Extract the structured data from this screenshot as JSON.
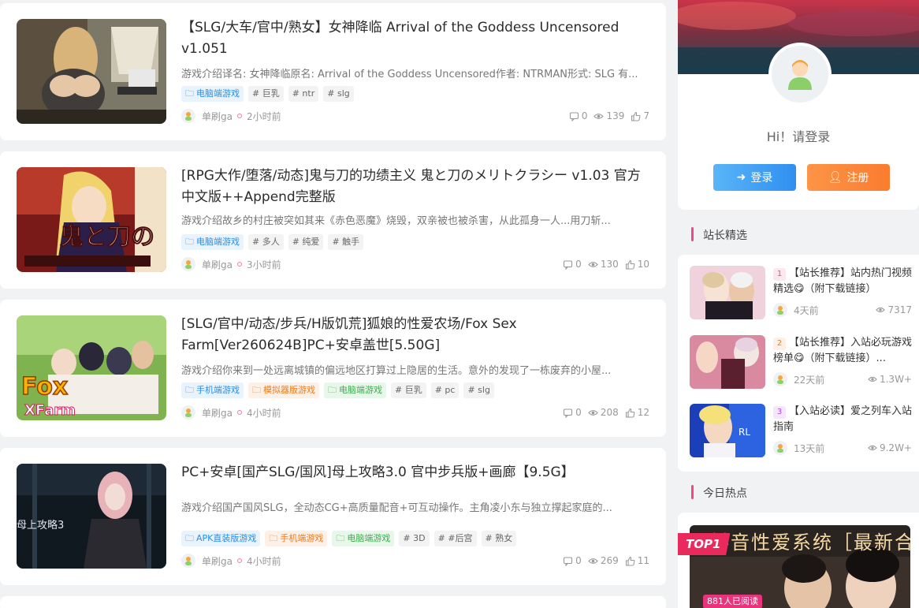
{
  "posts": [
    {
      "title": "【SLG/大车/官中/熟女】女神降临 Arrival of the Goddess Uncensored v1.051",
      "excerpt": "游戏介绍译名: 女神降临原名: Arrival of the Goddess Uncensored作者: NTRMAN形式: SLG 有...",
      "tags": [
        {
          "label": "电脑端游戏",
          "style": "blue",
          "icon": "folder-icon"
        },
        {
          "label": "# 巨乳",
          "style": "gray"
        },
        {
          "label": "# ntr",
          "style": "gray"
        },
        {
          "label": "# slg",
          "style": "gray"
        }
      ],
      "author": "单刷ga",
      "time": "2小时前",
      "comments": "0",
      "views": "139",
      "likes": "7"
    },
    {
      "title": "[RPG大作/堕落/动态]鬼与刀的功绩主义 鬼と刀のメリトクラシー v1.03 官方中文版++Append完整版",
      "excerpt": "游戏介绍故乡的村庄被突如其来《赤色恶魔》烧毁，双亲被也被杀害，从此孤身一人...用刀斩...",
      "tags": [
        {
          "label": "电脑端游戏",
          "style": "blue",
          "icon": "folder-icon"
        },
        {
          "label": "# 多人",
          "style": "gray"
        },
        {
          "label": "# 纯爱",
          "style": "gray"
        },
        {
          "label": "# 触手",
          "style": "gray"
        }
      ],
      "author": "单刷ga",
      "time": "3小时前",
      "comments": "0",
      "views": "130",
      "likes": "10"
    },
    {
      "title": "[SLG/官中/动态/步兵/H版饥荒]狐娘的性爱农场/Fox Sex Farm[Ver260624B]PC+安卓盖世[5.50G]",
      "excerpt": "游戏介绍你来到一处远离城镇的偏远地区打算过上隐居的生活。意外的发现了一栋废弃的小屋...",
      "tags": [
        {
          "label": "手机端游戏",
          "style": "blue",
          "icon": "folder-icon"
        },
        {
          "label": "模拟器版游戏",
          "style": "orange",
          "icon": "folder-icon"
        },
        {
          "label": "电脑端游戏",
          "style": "green",
          "icon": "folder-icon"
        },
        {
          "label": "# 巨乳",
          "style": "gray"
        },
        {
          "label": "# pc",
          "style": "gray"
        },
        {
          "label": "# slg",
          "style": "gray"
        }
      ],
      "author": "单刷ga",
      "time": "4小时前",
      "comments": "0",
      "views": "208",
      "likes": "12"
    },
    {
      "title": "PC+安卓[国产SLG/国风]母上攻略3.0 官中步兵版+画廊【9.5G】",
      "excerpt": "游戏介绍国产国风SLG，全动态CG+高质量配音+可互动操作。主角凌小东与独立撑起家庭的...",
      "tags": [
        {
          "label": "APK直装版游戏",
          "style": "blue",
          "icon": "folder-icon"
        },
        {
          "label": "手机端游戏",
          "style": "orange",
          "icon": "folder-icon"
        },
        {
          "label": "电脑端游戏",
          "style": "green",
          "icon": "folder-icon"
        },
        {
          "label": "# 3D",
          "style": "gray"
        },
        {
          "label": "# #后宫",
          "style": "gray"
        },
        {
          "label": "# 熟女",
          "style": "gray"
        }
      ],
      "author": "单刷ga",
      "time": "4小时前",
      "comments": "0",
      "views": "269",
      "likes": "11"
    }
  ],
  "sidebar": {
    "greeting": "Hi！请登录",
    "login_label": "登录",
    "register_label": "注册",
    "picks_title": "站长精选",
    "picks": [
      {
        "rank": "1",
        "title": "【站长推荐】站内热门视频精选😋（附下载链接）",
        "time": "4天前",
        "views": "7317",
        "rank_color": "#f44b7e"
      },
      {
        "rank": "2",
        "title": "【站长推荐】入站必玩游戏榜单😋（附下载链接）...",
        "time": "22天前",
        "views": "1.3W+",
        "rank_color": "#f57c25"
      },
      {
        "rank": "3",
        "title": "【入站必读】爱之列车入站指南",
        "time": "13天前",
        "views": "9.2W+",
        "rank_color": "#b445e6"
      }
    ],
    "hot_title": "今日热点",
    "hot": {
      "badge": "TOP1",
      "banner_text": "抖音性爱系统［最新合集］",
      "readers": "881人已阅读"
    }
  },
  "colors": {
    "accent_pink": "#f0488a",
    "tag_blue": "#2a8ee8",
    "tag_orange": "#f07b1c",
    "tag_green": "#3bae4d",
    "login_blue": "#2f8ff0",
    "register_orange": "#fb7c2f"
  }
}
